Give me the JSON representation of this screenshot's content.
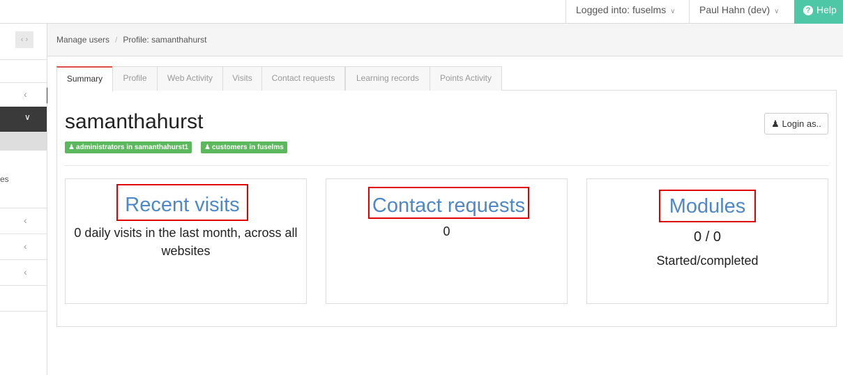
{
  "topbar": {
    "logged_into": "Logged into: fuselms",
    "user": "Paul Hahn (dev)",
    "help": "Help",
    "accent_color": "#4ec7a6"
  },
  "sidebar": {
    "toggle_icon": "left-right-chevrons-icon",
    "partial_text": "es"
  },
  "breadcrumb": {
    "items": [
      "Manage users",
      "Profile: samanthahurst"
    ],
    "separator": "/"
  },
  "tabs": [
    {
      "label": "Summary",
      "active": true
    },
    {
      "label": "Profile"
    },
    {
      "label": "Web Activity"
    },
    {
      "label": "Visits"
    },
    {
      "label": "Contact requests"
    },
    {
      "label": "Learning records"
    },
    {
      "label": "Points Activity"
    }
  ],
  "profile": {
    "username": "samanthahurst",
    "badges": [
      "administrators in samanthahurst1",
      "customers in fuselms"
    ],
    "badge_color": "#5cb85c",
    "login_as": "Login as.."
  },
  "cards": [
    {
      "title": "Recent visits",
      "lines": [
        "0 daily visits in the last month, across all websites"
      ]
    },
    {
      "title": "Contact requests",
      "lines": [
        "0"
      ]
    },
    {
      "title": "Modules",
      "lines": [
        "0 / 0",
        "Started/completed"
      ]
    }
  ],
  "colors": {
    "card_title": "#4f88c6",
    "highlight_border": "#e00000",
    "active_tab_border": "#e04b4b"
  }
}
